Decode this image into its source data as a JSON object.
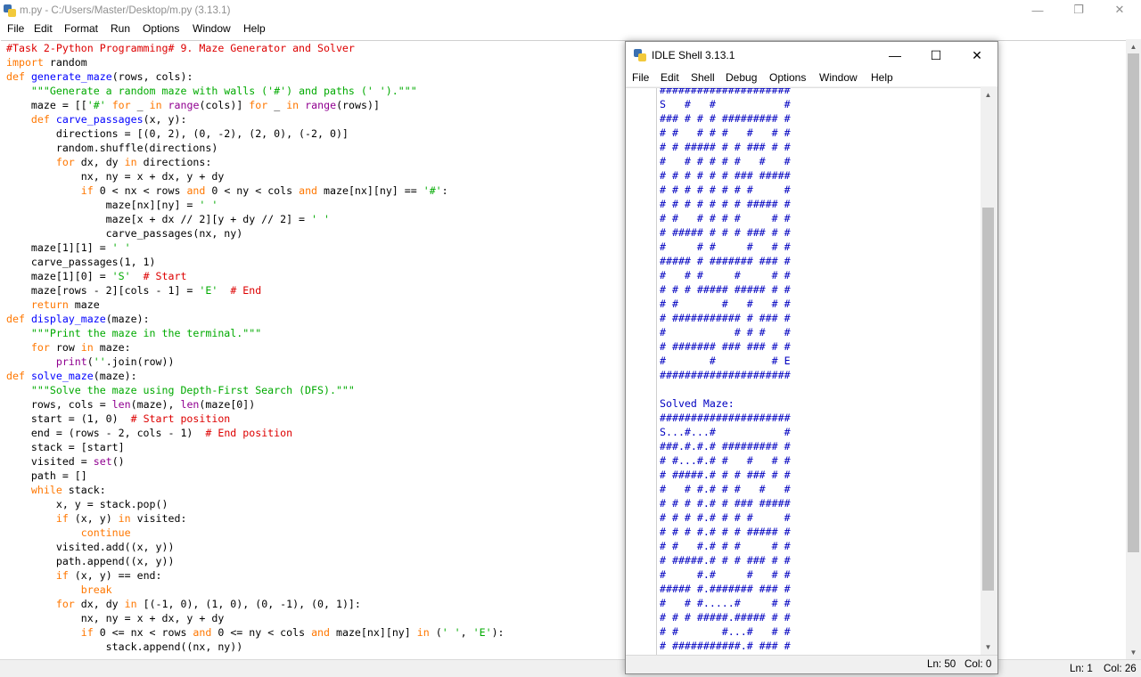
{
  "editor": {
    "title": "m.py - C:/Users/Master/Desktop/m.py (3.13.1)",
    "menu": [
      "File",
      "Edit",
      "Format",
      "Run",
      "Options",
      "Window",
      "Help"
    ],
    "status": {
      "line": "Ln: 1",
      "col": "Col: 26"
    },
    "code_lines": [
      "#Task 2-Python Programming# 9. Maze Generator and Solver",
      "import random",
      "def generate_maze(rows, cols):",
      "    \"\"\"Generate a random maze with walls ('#') and paths (' ').\"\"\"",
      "    maze = [['#' for _ in range(cols)] for _ in range(rows)]",
      "    def carve_passages(x, y):",
      "        directions = [(0, 2), (0, -2), (2, 0), (-2, 0)]",
      "        random.shuffle(directions)",
      "        for dx, dy in directions:",
      "            nx, ny = x + dx, y + dy",
      "            if 0 < nx < rows and 0 < ny < cols and maze[nx][ny] == '#':",
      "                maze[nx][ny] = ' '",
      "                maze[x + dx // 2][y + dy // 2] = ' '",
      "                carve_passages(nx, ny)",
      "    maze[1][1] = ' '",
      "    carve_passages(1, 1)",
      "    maze[1][0] = 'S'  # Start",
      "    maze[rows - 2][cols - 1] = 'E'  # End",
      "    return maze",
      "def display_maze(maze):",
      "    \"\"\"Print the maze in the terminal.\"\"\"",
      "    for row in maze:",
      "        print(''.join(row))",
      "def solve_maze(maze):",
      "    \"\"\"Solve the maze using Depth-First Search (DFS).\"\"\"",
      "    rows, cols = len(maze), len(maze[0])",
      "    start = (1, 0)  # Start position",
      "    end = (rows - 2, cols - 1)  # End position",
      "    stack = [start]",
      "    visited = set()",
      "    path = []",
      "    while stack:",
      "        x, y = stack.pop()",
      "        if (x, y) in visited:",
      "            continue",
      "        visited.add((x, y))",
      "        path.append((x, y))",
      "        if (x, y) == end:",
      "            break",
      "        for dx, dy in [(-1, 0), (1, 0), (0, -1), (0, 1)]:",
      "            nx, ny = x + dx, y + dy",
      "            if 0 <= nx < rows and 0 <= ny < cols and maze[nx][ny] in (' ', 'E'):",
      "                stack.append((nx, ny))"
    ]
  },
  "shell": {
    "title": "IDLE Shell 3.13.1",
    "menu": [
      "File",
      "Edit",
      "Shell",
      "Debug",
      "Options",
      "Window",
      "Help"
    ],
    "status": {
      "line": "Ln: 50",
      "col": "Col: 0"
    },
    "output_lines": [
      "#####################",
      "S   #   #           #",
      "### # # # ######### #",
      "# #   # # #   #   # #",
      "# # ##### # # ### # #",
      "#   # # # # #   #   #",
      "# # # # # # ### #####",
      "# # # # # # # #     #",
      "# # # # # # # ##### #",
      "# #   # # # #     # #",
      "# ##### # # # ### # #",
      "#     # #     #   # #",
      "##### # ####### ### #",
      "#   # #     #     # #",
      "# # # ##### ##### # #",
      "# #       #   #   # #",
      "# ########### # ### #",
      "#           # # #   #",
      "# ####### ### ### # #",
      "#       #         # E",
      "#####################",
      "",
      "Solved Maze:",
      "#####################",
      "S...#...#           #",
      "###.#.#.# ######### #",
      "# #...#.# #   #   # #",
      "# #####.# # # ### # #",
      "#   # #.# # #   #   #",
      "# # # #.# # ### #####",
      "# # # #.# # # #     #",
      "# # # #.# # # ##### #",
      "# #   #.# # #     # #",
      "# #####.# # # ### # #",
      "#     #.#     #   # #",
      "##### #.####### ### #",
      "#   # #.....#     # #",
      "# # # #####.##### # #",
      "# #       #...#   # #",
      "# ###########.# ### #"
    ]
  }
}
